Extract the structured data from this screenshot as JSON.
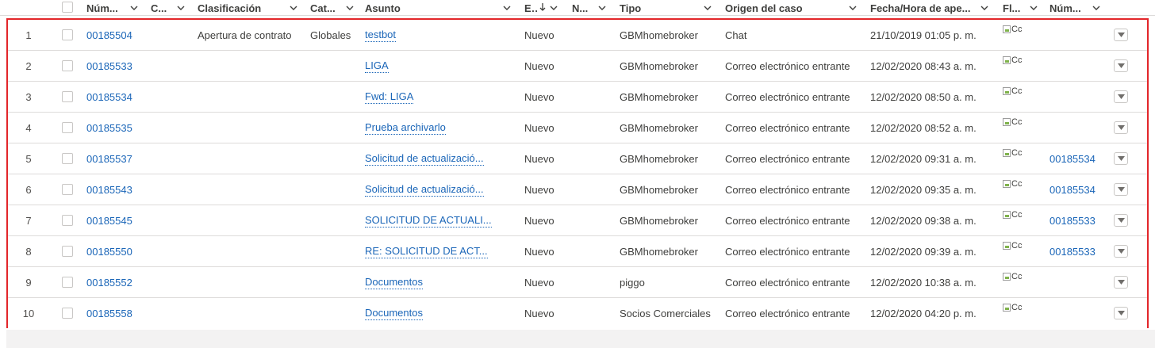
{
  "columns": {
    "numero": "Núm...",
    "c": "C...",
    "clasificacion": "Clasificación",
    "categoria": "Cat...",
    "asunto": "Asunto",
    "estado": "E...",
    "n": "N...",
    "tipo": "Tipo",
    "origen": "Origen del caso",
    "fecha": "Fecha/Hora de ape...",
    "fl": "Fl...",
    "numero2": "Núm..."
  },
  "rows": [
    {
      "n": "1",
      "numero": "00185504",
      "clasificacion": "Apertura de contrato",
      "categoria": "Globales",
      "asunto": "testbot",
      "estado": "Nuevo",
      "tipo": "GBMhomebroker",
      "origen": "Chat",
      "fecha": "21/10/2019 01:05 p. m.",
      "img_alt": "Cc",
      "numero2": ""
    },
    {
      "n": "2",
      "numero": "00185533",
      "clasificacion": "",
      "categoria": "",
      "asunto": "LIGA",
      "estado": "Nuevo",
      "tipo": "GBMhomebroker",
      "origen": "Correo electrónico entrante",
      "fecha": "12/02/2020 08:43 a. m.",
      "img_alt": "Cc",
      "numero2": ""
    },
    {
      "n": "3",
      "numero": "00185534",
      "clasificacion": "",
      "categoria": "",
      "asunto": "Fwd: LIGA",
      "estado": "Nuevo",
      "tipo": "GBMhomebroker",
      "origen": "Correo electrónico entrante",
      "fecha": "12/02/2020 08:50 a. m.",
      "img_alt": "Cc",
      "numero2": ""
    },
    {
      "n": "4",
      "numero": "00185535",
      "clasificacion": "",
      "categoria": "",
      "asunto": "Prueba archivarlo",
      "estado": "Nuevo",
      "tipo": "GBMhomebroker",
      "origen": "Correo electrónico entrante",
      "fecha": "12/02/2020 08:52 a. m.",
      "img_alt": "Cc",
      "numero2": ""
    },
    {
      "n": "5",
      "numero": "00185537",
      "clasificacion": "",
      "categoria": "",
      "asunto": "Solicitud de actualizació...",
      "estado": "Nuevo",
      "tipo": "GBMhomebroker",
      "origen": "Correo electrónico entrante",
      "fecha": "12/02/2020 09:31 a. m.",
      "img_alt": "Cc",
      "numero2": "00185534"
    },
    {
      "n": "6",
      "numero": "00185543",
      "clasificacion": "",
      "categoria": "",
      "asunto": "Solicitud de actualizació...",
      "estado": "Nuevo",
      "tipo": "GBMhomebroker",
      "origen": "Correo electrónico entrante",
      "fecha": "12/02/2020 09:35 a. m.",
      "img_alt": "Cc",
      "numero2": "00185534"
    },
    {
      "n": "7",
      "numero": "00185545",
      "clasificacion": "",
      "categoria": "",
      "asunto": "SOLICITUD DE ACTUALI...",
      "estado": "Nuevo",
      "tipo": "GBMhomebroker",
      "origen": "Correo electrónico entrante",
      "fecha": "12/02/2020 09:38 a. m.",
      "img_alt": "Cc",
      "numero2": "00185533"
    },
    {
      "n": "8",
      "numero": "00185550",
      "clasificacion": "",
      "categoria": "",
      "asunto": "RE: SOLICITUD DE ACT...",
      "estado": "Nuevo",
      "tipo": "GBMhomebroker",
      "origen": "Correo electrónico entrante",
      "fecha": "12/02/2020 09:39 a. m.",
      "img_alt": "Cc",
      "numero2": "00185533"
    },
    {
      "n": "9",
      "numero": "00185552",
      "clasificacion": "",
      "categoria": "",
      "asunto": "Documentos",
      "estado": "Nuevo",
      "tipo": "piggo",
      "origen": "Correo electrónico entrante",
      "fecha": "12/02/2020 10:38 a. m.",
      "img_alt": "Cc",
      "numero2": ""
    },
    {
      "n": "10",
      "numero": "00185558",
      "clasificacion": "",
      "categoria": "",
      "asunto": "Documentos",
      "estado": "Nuevo",
      "tipo": "Socios Comerciales",
      "origen": "Correo electrónico entrante",
      "fecha": "12/02/2020 04:20 p. m.",
      "img_alt": "Cc",
      "numero2": ""
    }
  ],
  "colors": {
    "link": "#1b66b8",
    "highlight_border": "#e3262a",
    "text": "#3e3e3c"
  },
  "icons": {
    "column_menu": "chevron-down-icon",
    "sort": "sort-descending-icon",
    "row_action": "caret-down-icon",
    "image": "broken-image-icon"
  }
}
